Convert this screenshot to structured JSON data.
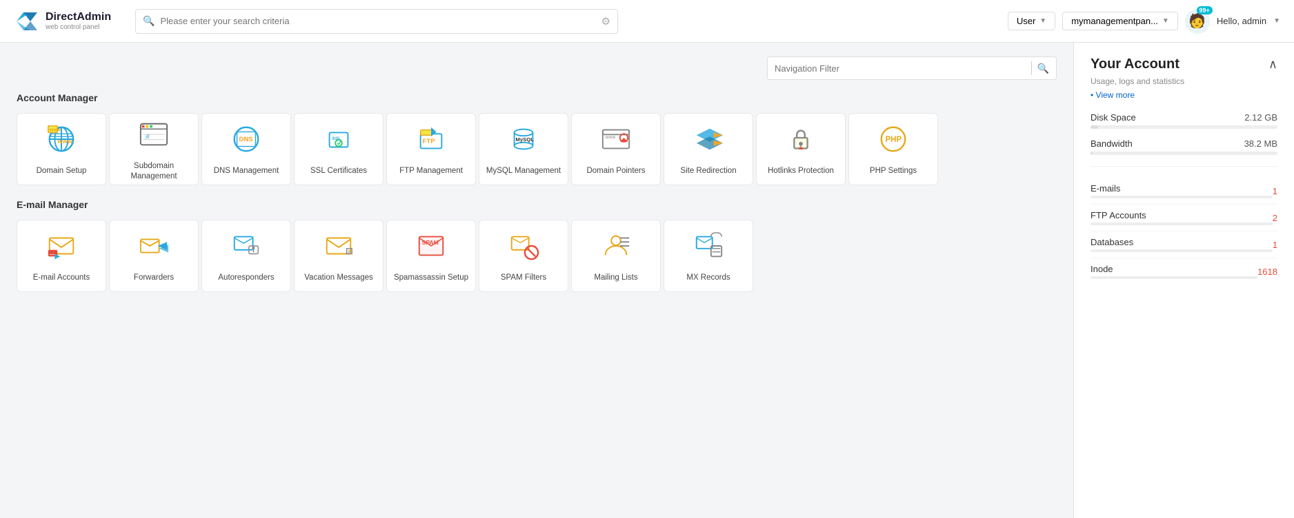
{
  "header": {
    "brand": "DirectAdmin",
    "sub": "web control panel",
    "search_placeholder": "Please enter your search criteria",
    "user_label": "User",
    "domain_label": "mymanagementpan...",
    "hello_text": "Hello, admin",
    "avatar_badge": "99+"
  },
  "nav_filter": {
    "placeholder": "Navigation Filter"
  },
  "account_manager": {
    "title": "Account Manager",
    "items": [
      {
        "label": "Domain Setup",
        "icon": "domain"
      },
      {
        "label": "Subdomain Management",
        "icon": "subdomain"
      },
      {
        "label": "DNS Management",
        "icon": "dns"
      },
      {
        "label": "SSL Certificates",
        "icon": "ssl"
      },
      {
        "label": "FTP Management",
        "icon": "ftp"
      },
      {
        "label": "MySQL Management",
        "icon": "mysql"
      },
      {
        "label": "Domain Pointers",
        "icon": "domainpointers"
      },
      {
        "label": "Site Redirection",
        "icon": "siteredirect"
      },
      {
        "label": "Hotlinks Protection",
        "icon": "hotlinks"
      },
      {
        "label": "PHP Settings",
        "icon": "php"
      }
    ]
  },
  "email_manager": {
    "title": "E-mail Manager",
    "items": [
      {
        "label": "E-mail Accounts",
        "icon": "emailaccounts"
      },
      {
        "label": "Forwarders",
        "icon": "forwarders"
      },
      {
        "label": "Autoresponders",
        "icon": "autoresponders"
      },
      {
        "label": "Vacation Messages",
        "icon": "vacation"
      },
      {
        "label": "Spamassassin Setup",
        "icon": "spam"
      },
      {
        "label": "SPAM Filters",
        "icon": "spamfilters"
      },
      {
        "label": "Mailing Lists",
        "icon": "mailinglists"
      },
      {
        "label": "MX Records",
        "icon": "mxrecords"
      }
    ]
  },
  "sidebar": {
    "title": "Your Account",
    "subtitle": "Usage, logs and statistics",
    "view_more": "• View more",
    "disk_space_label": "Disk Space",
    "disk_space_value": "2.12 GB",
    "bandwidth_label": "Bandwidth",
    "bandwidth_value": "38.2 MB",
    "stats": [
      {
        "label": "E-mails",
        "value": "1"
      },
      {
        "label": "FTP Accounts",
        "value": "2"
      },
      {
        "label": "Databases",
        "value": "1"
      },
      {
        "label": "Inode",
        "value": "1618"
      }
    ]
  },
  "icons": {
    "domain": "🌐",
    "subdomain": "🖥",
    "dns": "🌐",
    "ssl": "📄",
    "ftp": "📤",
    "mysql": "🗄",
    "domainpointers": "🖥",
    "siteredirect": "⏩",
    "hotlinks": "🔒",
    "php": "⚙",
    "emailaccounts": "📧",
    "forwarders": "📨",
    "autoresponders": "🤖",
    "vacation": "✉",
    "spam": "🛡",
    "spamfilters": "🚫",
    "mailinglists": "📋",
    "mxrecords": "📬"
  }
}
